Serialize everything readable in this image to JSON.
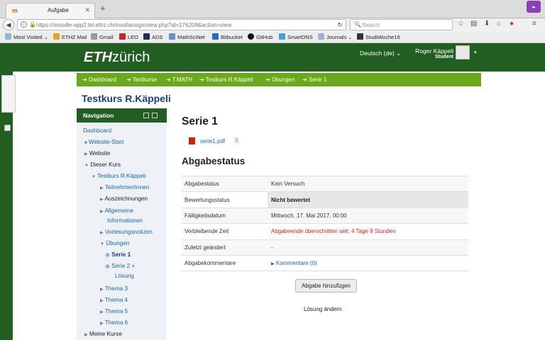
{
  "browser": {
    "tab_title": "Aufgabe",
    "tab_favicon": "m",
    "url": "https://moodle-app2.let.ethz.ch/mod/assign/view.php?id=176208&action=view",
    "search_placeholder": "Search",
    "bookmarks": [
      "Most Visited ⌄",
      "ETHZ Mail",
      "Gmail",
      "LEO",
      "ADS",
      "MathSciNet",
      "Bitbucket",
      "GitHub",
      "SmartDNS",
      "Journals ⌄",
      "StudiWoche16"
    ]
  },
  "header": {
    "logo_bold": "ETH",
    "logo_light": "zürich",
    "language": "Deutsch (de) ⌄",
    "user_name": "Roger Käppeli",
    "user_role": "Student"
  },
  "breadcrumb": [
    "Dashboard",
    "Testkurse",
    "T.MATH",
    "Testkurs R.Käppeli",
    "Übungen",
    "Serie 1"
  ],
  "course_title": "Testkurs R.Käppeli",
  "navigation": {
    "title": "Navigation",
    "items": [
      "Dashboard",
      "Website-Start",
      "Website",
      "Dieser Kurs",
      "Testkurs R.Käppeli",
      "Teilnehmer/innen",
      "Auszeichnungen",
      "Allgemeine",
      "Informationen",
      "Vorlesungsnotizen",
      "Übungen",
      "Serie 1",
      "Serie 2 +",
      "Lösung",
      "Thema 3",
      "Thema 4",
      "Thema 5",
      "Thema 6",
      "Meine Kurse"
    ]
  },
  "main": {
    "title": "Serie 1",
    "file": "serie1.pdf",
    "status_heading": "Abgabestatus",
    "rows": [
      {
        "label": "Abgabestatus",
        "value": "Kein Versuch"
      },
      {
        "label": "Bewertungsstatus",
        "value": "Nicht bewertet"
      },
      {
        "label": "Fälligkeitsdatum",
        "value": "Mittwoch, 17. Mai 2017, 00:00"
      },
      {
        "label": "Verbleibende Zeit",
        "value": "Abgabeende überschritten seit: 4 Tage 9 Stunden"
      },
      {
        "label": "Zuletzt geändert",
        "value": "-"
      },
      {
        "label": "Abgabekommentare",
        "value": "Kommentare (0)"
      }
    ],
    "submit_button": "Abgabe hinzufügen",
    "edit_solution": "Lösung ändern"
  },
  "colors": {
    "header_green": "#225e21",
    "breadcrumb_green": "#6aaa1a",
    "link_blue": "#1a64b0",
    "alert_red": "#d81e1e"
  }
}
